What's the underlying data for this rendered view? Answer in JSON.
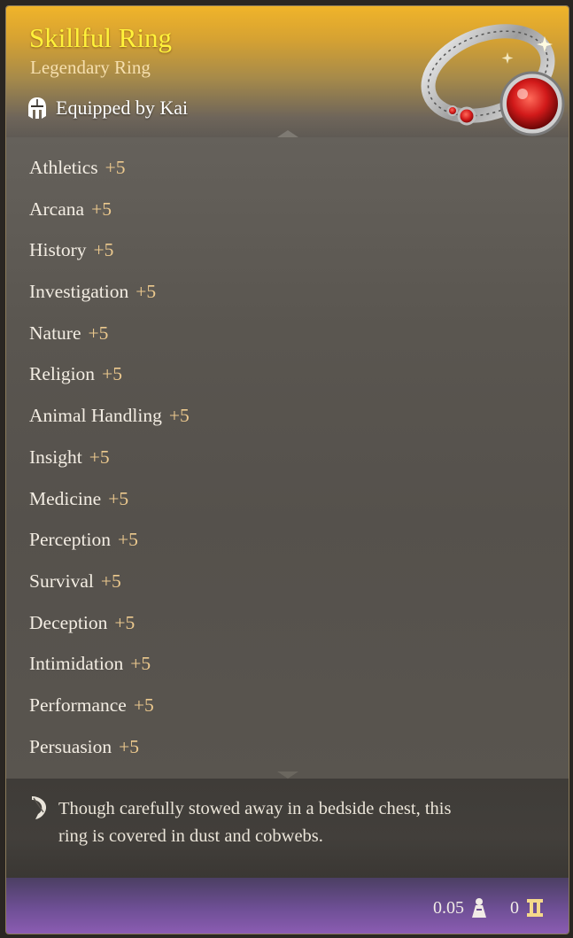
{
  "item": {
    "name": "Skillful Ring",
    "rarity_type": "Legendary Ring",
    "equipped_by": "Equipped by Kai",
    "icons": {
      "equipped": "helmet-icon",
      "artwork": "ring-artwork",
      "flavor": "quill-icon",
      "weight": "weight-icon",
      "value": "gold-icon"
    },
    "colors": {
      "title": "#fff23a",
      "bonus": "#ecc98e",
      "header_top": "#f0b42a",
      "footer_purple": "#8a5cb2"
    }
  },
  "properties": [
    {
      "name": "Athletics",
      "value": "+5"
    },
    {
      "name": "Arcana",
      "value": "+5"
    },
    {
      "name": "History",
      "value": "+5"
    },
    {
      "name": "Investigation",
      "value": "+5"
    },
    {
      "name": "Nature",
      "value": "+5"
    },
    {
      "name": "Religion",
      "value": "+5"
    },
    {
      "name": "Animal Handling",
      "value": "+5"
    },
    {
      "name": "Insight",
      "value": "+5"
    },
    {
      "name": "Medicine",
      "value": "+5"
    },
    {
      "name": "Perception",
      "value": "+5"
    },
    {
      "name": "Survival",
      "value": "+5"
    },
    {
      "name": "Deception",
      "value": "+5"
    },
    {
      "name": "Intimidation",
      "value": "+5"
    },
    {
      "name": "Performance",
      "value": "+5"
    },
    {
      "name": "Persuasion",
      "value": "+5"
    }
  ],
  "flavor": {
    "line1": "Though carefully stowed away in a bedside chest, this",
    "line2": "ring is covered in dust and cobwebs."
  },
  "footer": {
    "weight": "0.05",
    "value": "0"
  }
}
